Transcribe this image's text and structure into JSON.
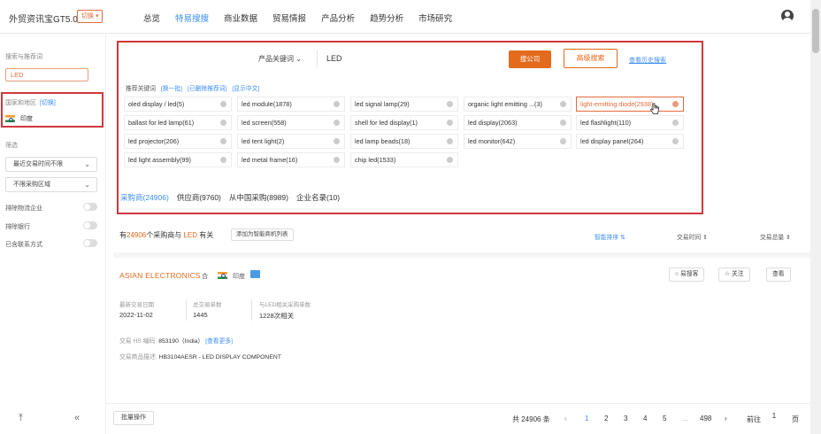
{
  "app": {
    "title": "外贸资讯宝GT5.0",
    "switch_label": "切换"
  },
  "nav": {
    "items": [
      "总览",
      "特易搜搜",
      "商业数据",
      "贸易情报",
      "产品分析",
      "趋势分析",
      "市场研究"
    ]
  },
  "sidebar": {
    "search_label": "搜索与推荐词",
    "search_tag": "LED",
    "region_label": "国家和地区",
    "region_switch": "[切换]",
    "region_value": "印度",
    "filter_label": "筛选",
    "select_trade_time": "最近交易时间不限",
    "select_region": "不限采购区域",
    "toggles": [
      "排除物流企业",
      "排除银行",
      "已含联系方式"
    ]
  },
  "search": {
    "type_label": "产品关键词",
    "query": "LED",
    "search_button": "搜公司",
    "advanced_button": "高级搜索",
    "history_link": "查看历史搜索",
    "rec_label": "推荐关键词",
    "rec_links": [
      "[换一批]",
      "[已删除推荐词]",
      "[显示中文]"
    ],
    "chips": [
      "oled display / led(5)",
      "led module(1878)",
      "led signal lamp(29)",
      "organic light emitting ...(3)",
      "light-emitting diode(2938)",
      "ballast for led lamp(61)",
      "led screen(558)",
      "shell for led display(1)",
      "led display(2063)",
      "led flashlight(110)",
      "led projector(206)",
      "led tent light(2)",
      "led lamp beads(18)",
      "led monitor(642)",
      "led display panel(264)",
      "led light assembly(99)",
      "led metal frame(16)",
      "chip led(1533)"
    ],
    "tabs": [
      "采购商(24906)",
      "供应商(9760)",
      "从中国采购(8989)",
      "企业名录(10)"
    ]
  },
  "results": {
    "prefix": "有",
    "count": "24906",
    "mid": "个采购商与",
    "keyword": "LED",
    "suffix": "有关",
    "add_button": "添加为智能商机列表",
    "sort_smart": "智能排序 ⇅",
    "sort_time": "交易时间 ⇕",
    "sort_total": "交易总量 ⇕"
  },
  "company": {
    "name": "ASIAN ELECTRONICS",
    "badge": "合",
    "country": "印度",
    "btn_similar": "易搜客",
    "btn_follow": "关注",
    "btn_view": "查看",
    "stats": [
      {
        "label": "最新交易日期",
        "value": "2022-11-02"
      },
      {
        "label": "总交易单数",
        "value": "1445"
      },
      {
        "label": "与LED相关采购单数",
        "value": "1228次相关"
      }
    ],
    "hs_label": "交易 HS 编码:",
    "hs_value": "853190（India）",
    "hs_more": "[查看更多]",
    "desc_label": "交易商品描述:",
    "desc_value": "HB3104AESR - LED DISPLAY COMPONENT"
  },
  "footer": {
    "batch_button": "批量操作",
    "total": "共 24906 条",
    "pages": [
      "1",
      "2",
      "3",
      "4",
      "5",
      "...",
      "498"
    ],
    "goto_label": "前往",
    "goto_value": "1",
    "page_unit": "页"
  },
  "colors": {
    "accent": "#e46b1d",
    "link": "#3d8ef0",
    "highlight_border": "#d0373d"
  }
}
